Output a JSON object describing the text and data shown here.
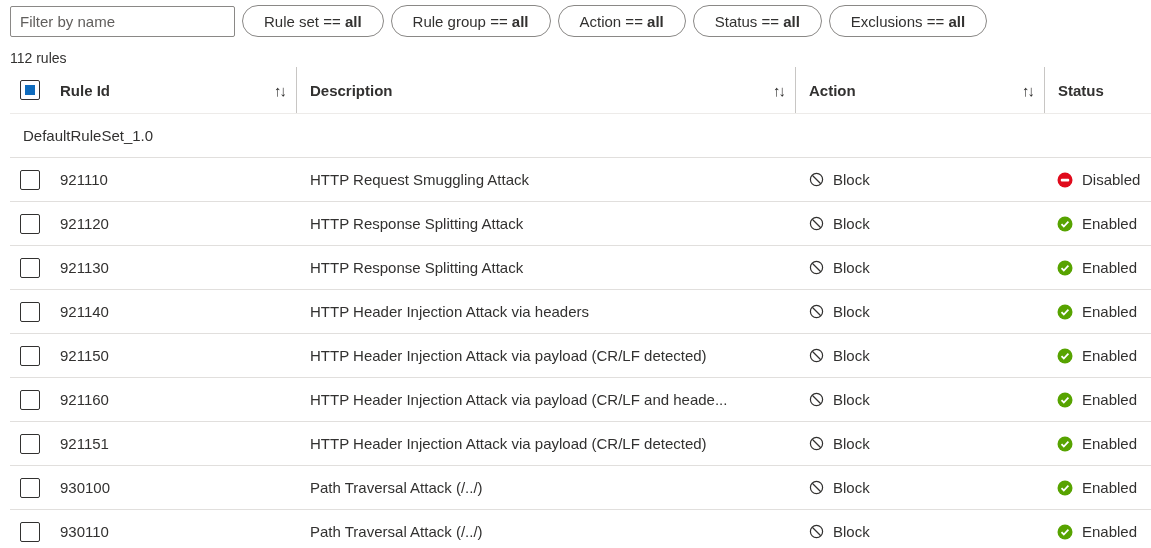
{
  "filter": {
    "placeholder": "Filter by name"
  },
  "pills": [
    {
      "label": "Rule set ==",
      "value": "all"
    },
    {
      "label": "Rule group ==",
      "value": "all"
    },
    {
      "label": "Action ==",
      "value": "all"
    },
    {
      "label": "Status ==",
      "value": "all"
    },
    {
      "label": "Exclusions ==",
      "value": "all"
    }
  ],
  "count": "112 rules",
  "table": {
    "select_all": {
      "indeterminate": true
    },
    "columns": [
      {
        "label": "Rule Id",
        "sort": "↑↓"
      },
      {
        "label": "Description",
        "sort": "↑↓"
      },
      {
        "label": "Action",
        "sort": "↑↓"
      },
      {
        "label": "Status"
      }
    ],
    "group": "DefaultRuleSet_1.0",
    "rows": [
      {
        "checked": false,
        "id": "921110",
        "description": "HTTP Request Smuggling Attack",
        "action": "Block",
        "status": {
          "kind": "disabled",
          "label": "Disabled"
        }
      },
      {
        "checked": false,
        "id": "921120",
        "description": "HTTP Response Splitting Attack",
        "action": "Block",
        "status": {
          "kind": "enabled",
          "label": "Enabled"
        }
      },
      {
        "checked": false,
        "id": "921130",
        "description": "HTTP Response Splitting Attack",
        "action": "Block",
        "status": {
          "kind": "enabled",
          "label": "Enabled"
        }
      },
      {
        "checked": false,
        "id": "921140",
        "description": "HTTP Header Injection Attack via headers",
        "action": "Block",
        "status": {
          "kind": "enabled",
          "label": "Enabled"
        }
      },
      {
        "checked": false,
        "id": "921150",
        "description": "HTTP Header Injection Attack via payload (CR/LF detected)",
        "action": "Block",
        "status": {
          "kind": "enabled",
          "label": "Enabled"
        }
      },
      {
        "checked": false,
        "id": "921160",
        "description": "HTTP Header Injection Attack via payload (CR/LF and heade...",
        "action": "Block",
        "status": {
          "kind": "enabled",
          "label": "Enabled"
        }
      },
      {
        "checked": false,
        "id": "921151",
        "description": "HTTP Header Injection Attack via payload (CR/LF detected)",
        "action": "Block",
        "status": {
          "kind": "enabled",
          "label": "Enabled"
        }
      },
      {
        "checked": false,
        "id": "930100",
        "description": "Path Traversal Attack (/../)",
        "action": "Block",
        "status": {
          "kind": "enabled",
          "label": "Enabled"
        }
      },
      {
        "checked": false,
        "id": "930110",
        "description": "Path Traversal Attack (/../)",
        "action": "Block",
        "status": {
          "kind": "enabled",
          "label": "Enabled"
        }
      }
    ]
  }
}
